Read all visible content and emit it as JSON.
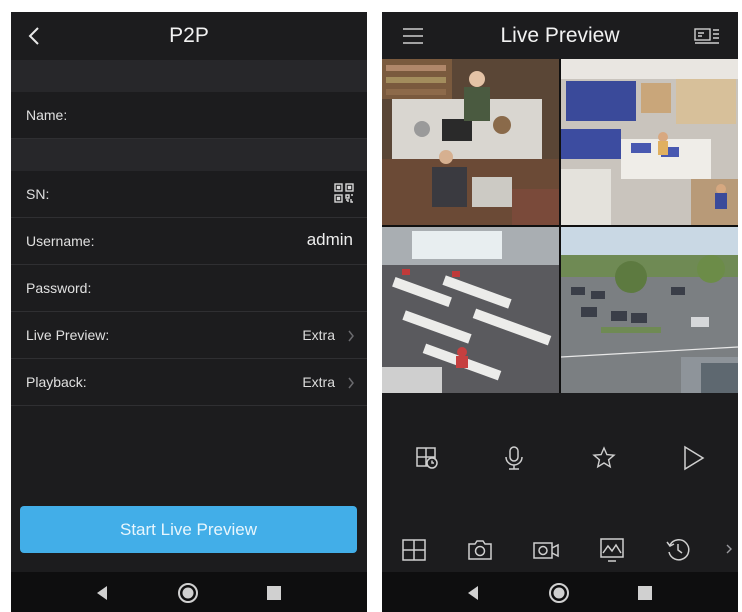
{
  "left_screen": {
    "header": {
      "title": "P2P"
    },
    "fields": {
      "name": {
        "label": "Name:",
        "value": ""
      },
      "sn": {
        "label": "SN:",
        "value": ""
      },
      "username": {
        "label": "Username:",
        "value": "admin"
      },
      "password": {
        "label": "Password:",
        "value": ""
      },
      "live_preview": {
        "label": "Live Preview:",
        "value": "Extra"
      },
      "playback": {
        "label": "Playback:",
        "value": "Extra"
      }
    },
    "start_button_label": "Start Live Preview"
  },
  "right_screen": {
    "header": {
      "title": "Live Preview"
    },
    "channels": [
      "camera-1",
      "camera-2",
      "camera-3",
      "camera-4"
    ]
  },
  "icons": {
    "back": "chevron-left-icon",
    "qr": "qr-code-icon",
    "menu": "menu-icon",
    "camera_list": "camera-list-icon",
    "playback_grid": "playback-grid-icon",
    "microphone": "microphone-icon",
    "favorite": "star-icon",
    "play": "play-icon",
    "split_layout": "split-layout-icon",
    "snapshot": "camera-icon",
    "record": "video-record-icon",
    "image_settings": "image-adjust-icon",
    "history": "history-icon",
    "more": "chevron-right-icon"
  },
  "colors": {
    "background": "#1c1c1e",
    "section_gap": "#27272a",
    "accent": "#42aee8",
    "nav_bar": "#0e0e0f",
    "text": "#e6e6e6"
  }
}
